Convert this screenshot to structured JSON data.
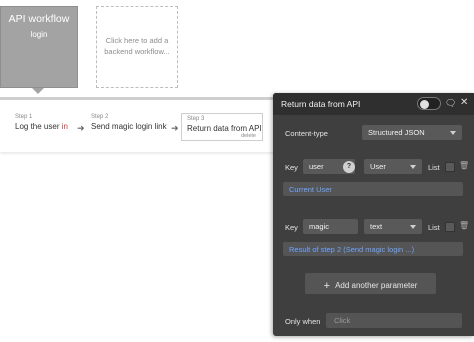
{
  "workflow_card": {
    "title": "API workflow",
    "subtitle": "login"
  },
  "add_backend_card": {
    "line1": "Click here to add a",
    "line2": "backend workflow..."
  },
  "steps": [
    {
      "num": "Step 1",
      "name_pre": "Log the user ",
      "name_red": "in"
    },
    {
      "num": "Step 2",
      "name": "Send magic login link"
    },
    {
      "num": "Step 3",
      "name": "Return data from API",
      "delete_label": "delete"
    }
  ],
  "panel": {
    "title": "Return data from API",
    "content_type": {
      "label": "Content-type",
      "value": "Structured JSON"
    },
    "params": [
      {
        "key_label": "Key",
        "key": "user",
        "type": "User",
        "list_label": "List",
        "value": "Current User"
      },
      {
        "key_label": "Key",
        "key": "magic",
        "type": "text",
        "list_label": "List",
        "value": "Result of step 2 (Send magic login ...)"
      }
    ],
    "add_param_label": "Add another parameter",
    "only_when": {
      "label": "Only when",
      "placeholder": "Click"
    }
  },
  "icons": {
    "toggle": "toggle-icon",
    "comment": "comment-icon",
    "close": "close-icon",
    "help": "help-icon",
    "trash": "trash-icon",
    "arrow": "arrow-right-icon"
  },
  "colors": {
    "panel_bg": "#3f3f3f",
    "header_bg": "#2f2f2f",
    "link_blue": "#6fa5ff",
    "accent_red": "#d23a3a",
    "card_gray": "#a3a3a3"
  }
}
